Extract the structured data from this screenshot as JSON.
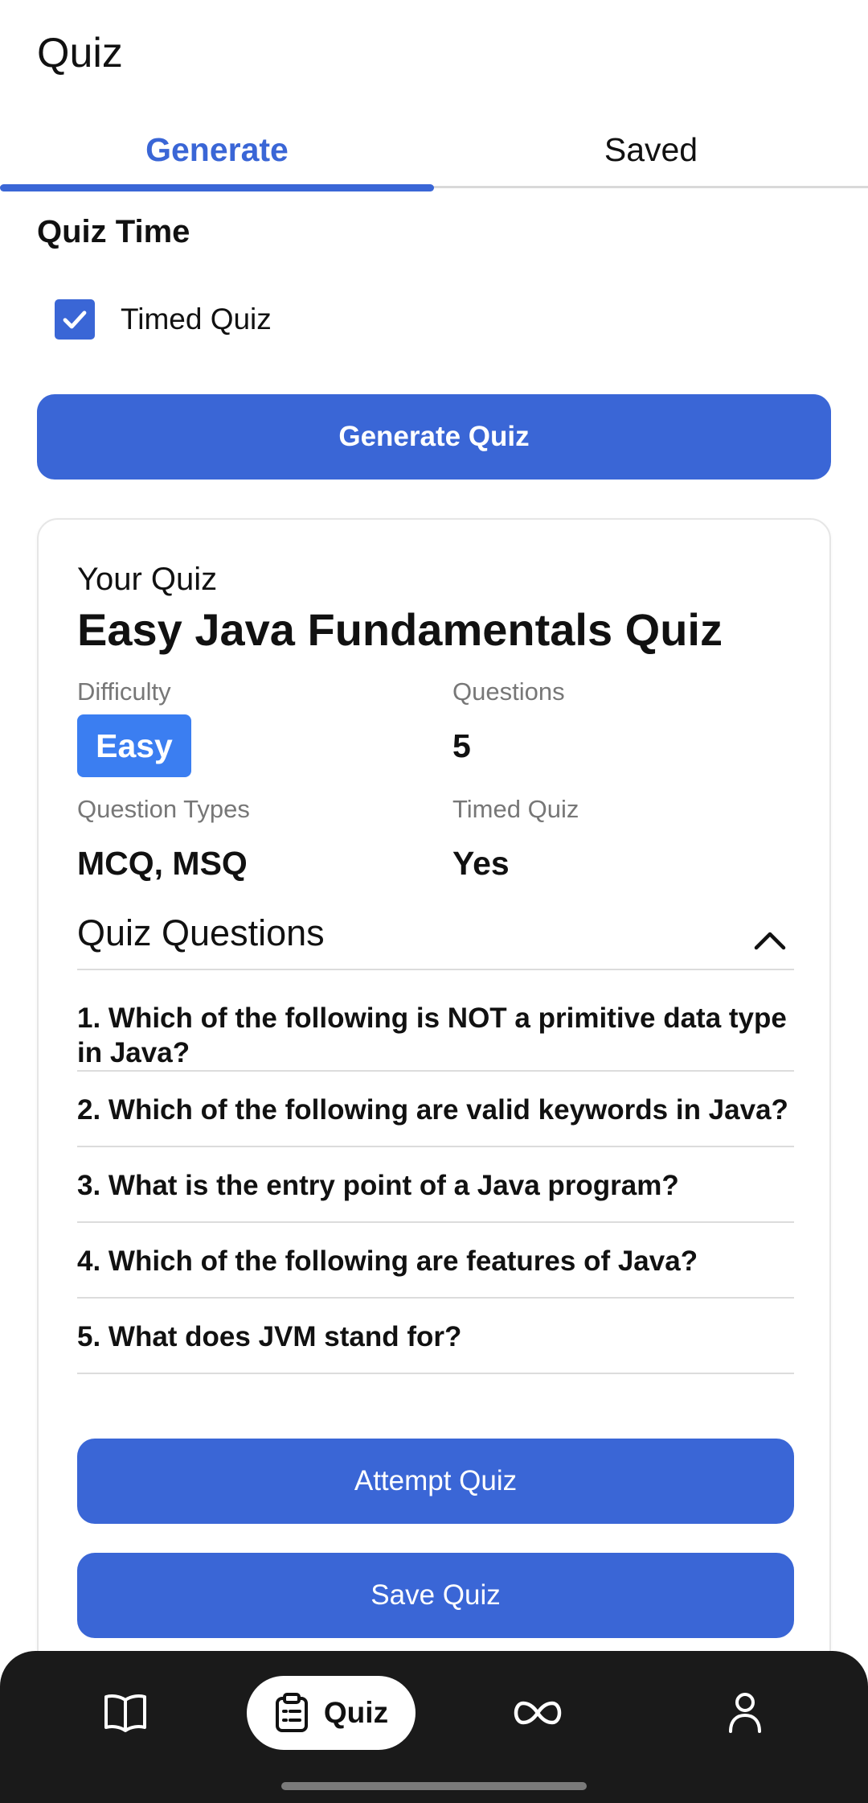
{
  "header": {
    "title": "Quiz"
  },
  "tabs": [
    {
      "label": "Generate",
      "active": true
    },
    {
      "label": "Saved",
      "active": false
    }
  ],
  "quiz_time": {
    "section_title": "Quiz Time",
    "timed_checkbox": {
      "label": "Timed Quiz",
      "checked": true
    }
  },
  "generate_button": {
    "label": "Generate Quiz"
  },
  "quiz_card": {
    "label": "Your Quiz",
    "title": "Easy Java Fundamentals Quiz",
    "difficulty": {
      "label": "Difficulty",
      "value": "Easy"
    },
    "questions_count": {
      "label": "Questions",
      "value": "5"
    },
    "question_types": {
      "label": "Question Types",
      "value": "MCQ, MSQ"
    },
    "timed": {
      "label": "Timed Quiz",
      "value": "Yes"
    },
    "questions_section": {
      "title": "Quiz Questions",
      "expanded": true
    },
    "questions": [
      "1. Which of the following is NOT a primitive data type in Java?",
      "2. Which of the following are valid keywords in Java?",
      "3. What is the entry point of a Java program?",
      "4. Which of the following are features of Java?",
      "5. What does JVM stand for?"
    ],
    "attempt_button": {
      "label": "Attempt Quiz"
    },
    "save_button": {
      "label": "Save Quiz"
    }
  },
  "bottom_nav": {
    "items": [
      {
        "icon": "book-icon",
        "label": ""
      },
      {
        "icon": "clipboard-icon",
        "label": "Quiz",
        "active": true
      },
      {
        "icon": "infinity-icon",
        "label": ""
      },
      {
        "icon": "person-icon",
        "label": ""
      }
    ]
  },
  "colors": {
    "accent": "#3a66d6",
    "badge": "#3b7ef1",
    "nav_background": "#1a1a1a"
  }
}
